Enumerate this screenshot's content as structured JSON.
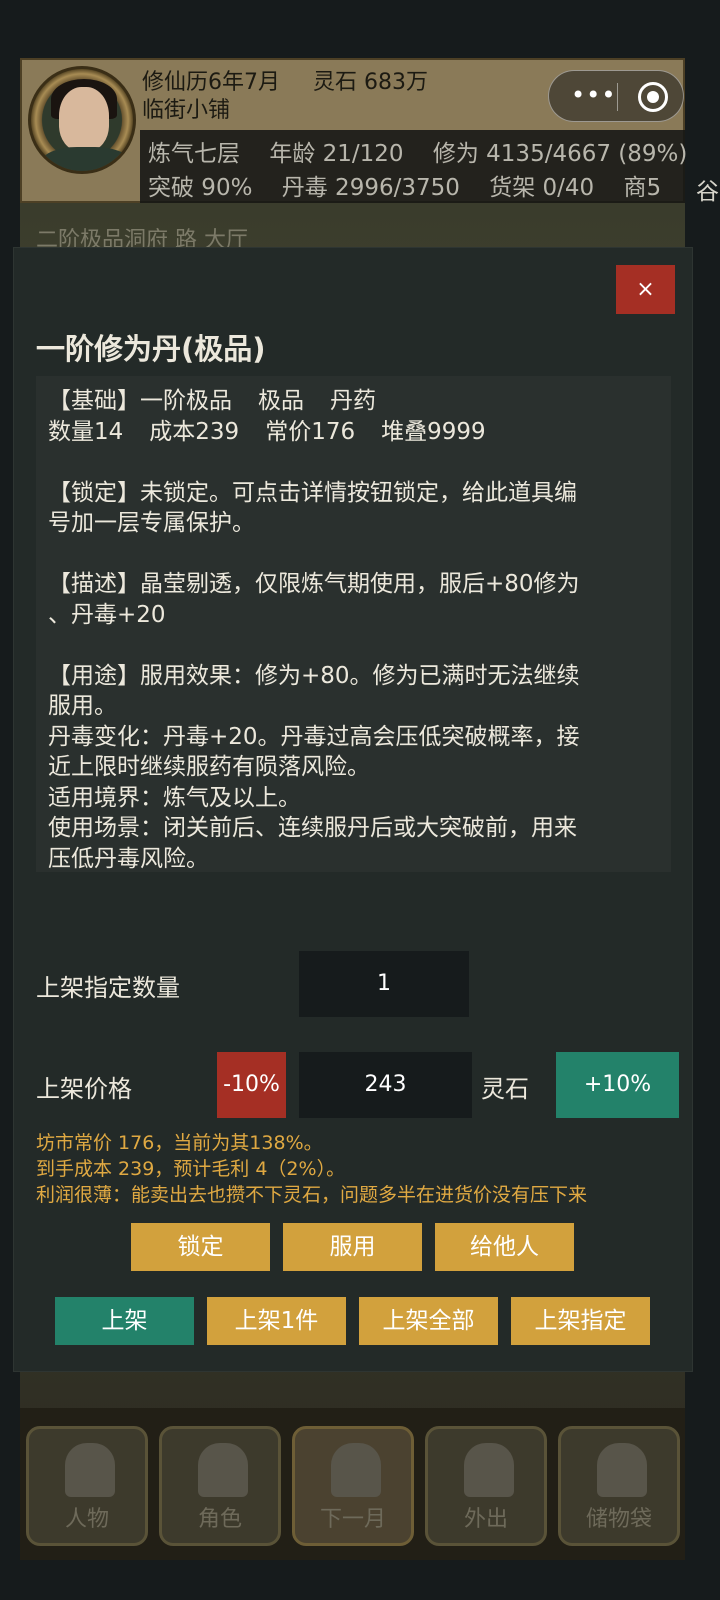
{
  "capsule": {
    "menu_icon": "more-dots-icon",
    "close_icon": "target-circle-icon"
  },
  "header": {
    "date": "修仙历6年7月",
    "spirit_stone": "灵石 683万",
    "shop_name": "临街小铺",
    "stats_row1": [
      "炼气七层",
      "年龄 21/120",
      "修为 4135/4667 (89%)"
    ],
    "stats_row2": [
      "突破 90%",
      "丹毒 2996/3750",
      "货架 0/40",
      "商5"
    ],
    "overflow_char": "谷",
    "location": "二阶极品洞府 路 大厅"
  },
  "modal": {
    "close_label": "×",
    "title": "一阶修为丹(极品)",
    "basic_line": [
      "【基础】一阶极品",
      "极品",
      "丹药"
    ],
    "qty_line": [
      "数量14",
      "成本239",
      "常价176",
      "堆叠9999"
    ],
    "lock_lines": [
      "【锁定】未锁定。可点击详情按钮锁定，给此道具编",
      "号加一层专属保护。"
    ],
    "desc_lines": [
      "【描述】晶莹剔透，仅限炼气期使用，服后+80修为",
      "、丹毒+20"
    ],
    "usage_lines": [
      "【用途】服用效果：修为+80。修为已满时无法继续",
      "服用。",
      "丹毒变化：丹毒+20。丹毒过高会压低突破概率，接",
      "近上限时继续服药有陨落风险。",
      "适用境界：炼气及以上。",
      "使用场景：闭关前后、连续服丹后或大突破前，用来",
      "压低丹毒风险。"
    ],
    "qty_label": "上架指定数量",
    "qty_value": "1",
    "price_label": "上架价格",
    "minus_label": "-10%",
    "price_value": "243",
    "currency_label": "灵石",
    "plus_label": "+10%",
    "hints": [
      "坊市常价 176，当前为其138%。",
      "到手成本 239，预计毛利 4（2%）。",
      "利润很薄：能卖出去也攒不下灵石，问题多半在进货价没有压下来"
    ],
    "action_row1": [
      "锁定",
      "服用",
      "给他人"
    ],
    "action_row2": [
      "上架",
      "上架1件",
      "上架全部",
      "上架指定"
    ]
  },
  "bottom_nav": [
    {
      "label": "人物",
      "icon": "person-icon"
    },
    {
      "label": "角色",
      "icon": "role-icon"
    },
    {
      "label": "下一月",
      "icon": "flag-icon"
    },
    {
      "label": "外出",
      "icon": "travel-icon"
    },
    {
      "label": "储物袋",
      "icon": "bag-icon"
    }
  ],
  "colors": {
    "accent_gold": "#d2a13d",
    "accent_green": "#23826a",
    "accent_red": "#a52f24",
    "hint_text": "#e0a942"
  }
}
